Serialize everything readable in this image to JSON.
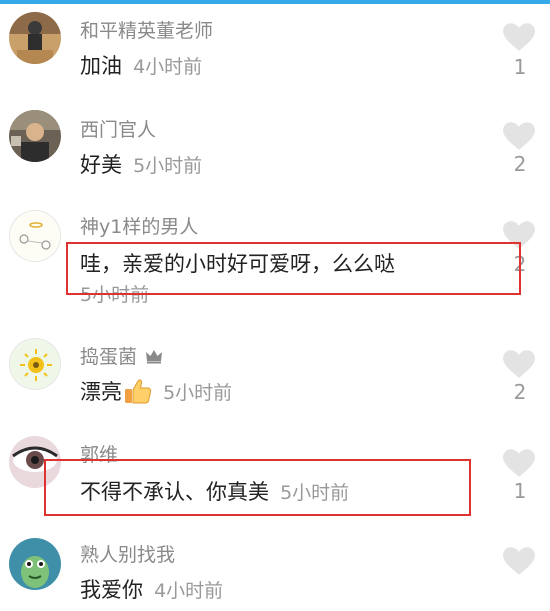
{
  "comments": [
    {
      "user": "和平精英董老师",
      "text": "加油",
      "time": "4小时前",
      "likes": "1"
    },
    {
      "user": "西门官人",
      "text": "好美",
      "time": "5小时前",
      "likes": "2"
    },
    {
      "user": "神y1样的男人",
      "text": "哇，亲爱的小时好可爱呀，么么哒",
      "time": "5小时前",
      "likes": "2"
    },
    {
      "user": "捣蛋菌",
      "text": "漂亮",
      "time": "5小时前",
      "likes": "2",
      "emoji_icon": "thumbs-up-icon",
      "badge_icon": "crown-icon"
    },
    {
      "user": "郭维",
      "text": "不得不承认、你真美",
      "time": "5小时前",
      "likes": "1"
    },
    {
      "user": "熟人别找我",
      "text": "我爱你",
      "time": "4小时前",
      "likes": ""
    }
  ],
  "colors": {
    "highlight_box": "#e03131",
    "heart": "#e3e3e3",
    "accent": "#36a9e8"
  }
}
